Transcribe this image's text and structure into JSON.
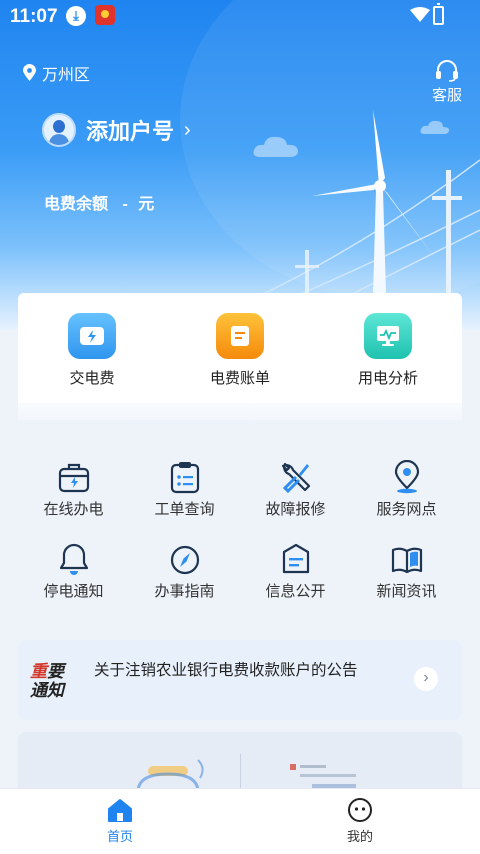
{
  "status_bar": {
    "time": "11:07"
  },
  "header": {
    "location": "万州区",
    "service_label": "客服"
  },
  "account": {
    "add_label": "添加户号",
    "balance_label": "电费余额",
    "balance_value": "-",
    "balance_unit": "元"
  },
  "quick_actions": [
    {
      "label": "交电费",
      "icon": "wallet-lightning-icon",
      "color": "#3ba6f2"
    },
    {
      "label": "电费账单",
      "icon": "bill-icon",
      "color": "#f7a21a"
    },
    {
      "label": "用电分析",
      "icon": "monitor-chart-icon",
      "color": "#2fcfc0"
    }
  ],
  "services": [
    {
      "label": "在线办电",
      "icon": "briefcase-lightning-icon"
    },
    {
      "label": "工单查询",
      "icon": "clipboard-list-icon"
    },
    {
      "label": "故障报修",
      "icon": "tools-icon"
    },
    {
      "label": "服务网点",
      "icon": "map-pin-icon"
    },
    {
      "label": "停电通知",
      "icon": "bell-icon"
    },
    {
      "label": "办事指南",
      "icon": "compass-icon"
    },
    {
      "label": "信息公开",
      "icon": "info-board-icon"
    },
    {
      "label": "新闻资讯",
      "icon": "open-book-icon"
    }
  ],
  "notice": {
    "badge_top": "重要",
    "badge_bottom": "通知",
    "text": "关于注销农业银行电费收款账户的公告"
  },
  "bottom_nav": [
    {
      "label": "首页",
      "active": true
    },
    {
      "label": "我的",
      "active": false
    }
  ],
  "colors": {
    "primary": "#1f84f0",
    "icon_dark": "#1e3552",
    "icon_accent": "#2e8ff0"
  }
}
